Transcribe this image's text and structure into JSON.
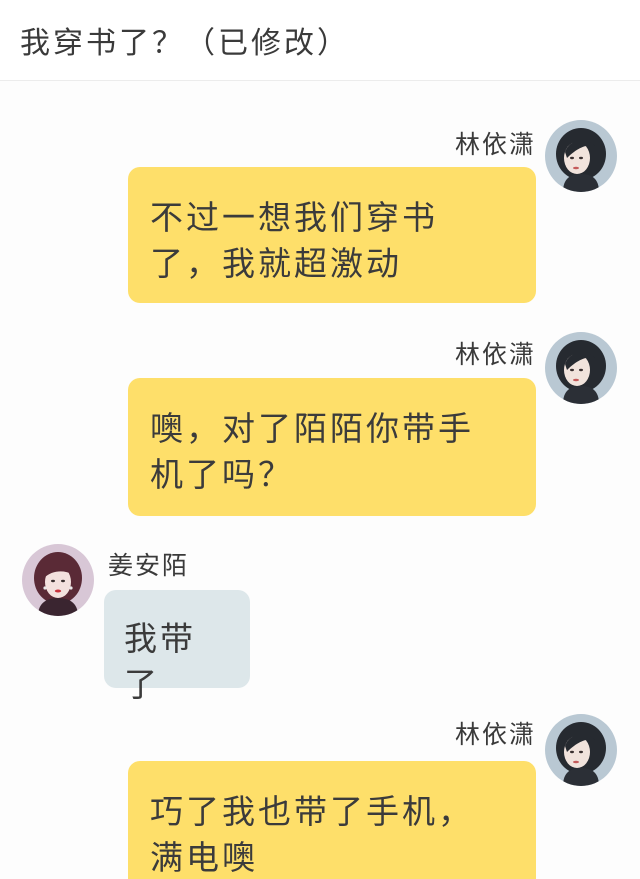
{
  "header": {
    "title": "我穿书了？（已修改）"
  },
  "colors": {
    "right_bubble": "#fedf6a",
    "left_bubble": "#dde7ea",
    "text": "#3b3b3b"
  },
  "messages": [
    {
      "side": "right",
      "sender": "林依潇",
      "avatar_icon": "female-avatar-dark-hair-icon",
      "lines": [
        "不过一想我们穿书",
        "了，我就超激动"
      ]
    },
    {
      "side": "right",
      "sender": "林依潇",
      "avatar_icon": "female-avatar-dark-hair-icon",
      "lines": [
        "噢，对了陌陌你带手",
        "机了吗？"
      ]
    },
    {
      "side": "left",
      "sender": "姜安陌",
      "avatar_icon": "female-avatar-red-hair-icon",
      "lines": [
        "我带了"
      ]
    },
    {
      "side": "right",
      "sender": "林依潇",
      "avatar_icon": "female-avatar-dark-hair-icon",
      "lines": [
        "巧了我也带了手机，",
        "满电噢"
      ]
    }
  ]
}
